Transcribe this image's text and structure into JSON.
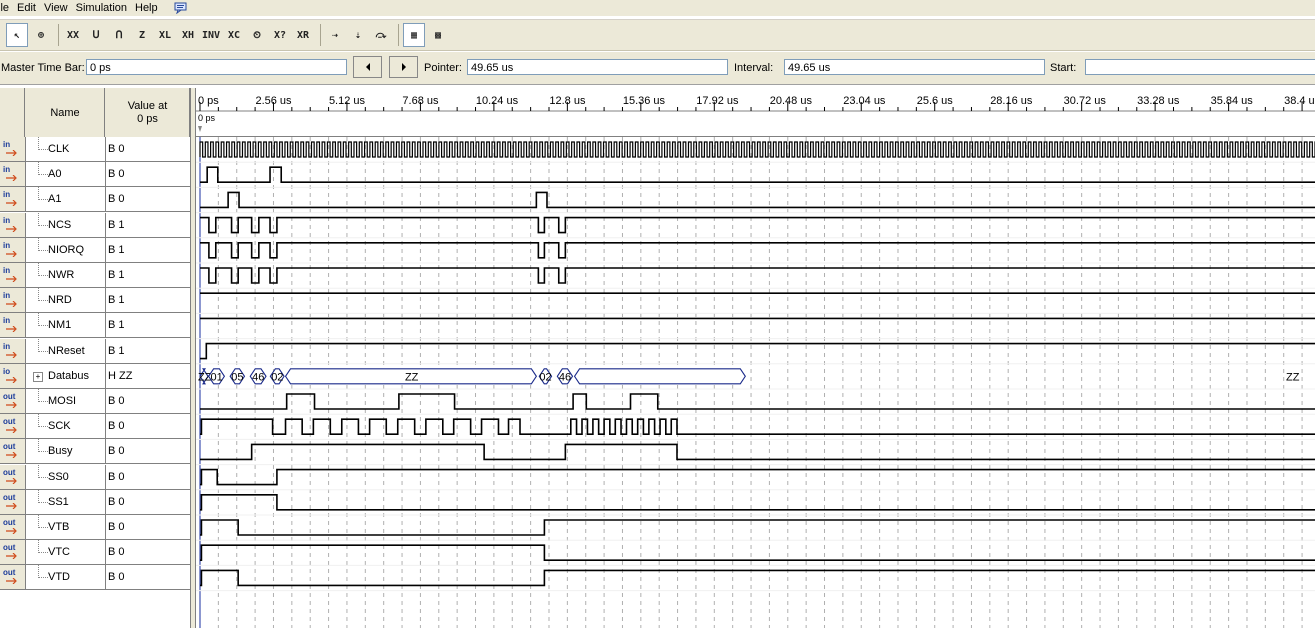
{
  "menu": {
    "items": [
      "ile",
      "Edit",
      "View",
      "Simulation",
      "Help"
    ]
  },
  "toolbar": {
    "buttons": [
      {
        "icon": "selection-tool-icon",
        "text": "↖"
      },
      {
        "icon": "zoom-tool-icon",
        "text": "⊕"
      },
      {
        "icon": "uninitialized-icon",
        "text": "XX"
      },
      {
        "icon": "forcing-low-icon",
        "text": "ᑌ"
      },
      {
        "icon": "forcing-high-icon",
        "text": "ᑎ"
      },
      {
        "icon": "high-impedance-icon",
        "text": "Z"
      },
      {
        "icon": "weak-low-icon",
        "text": "XL"
      },
      {
        "icon": "weak-high-icon",
        "text": "XH"
      },
      {
        "icon": "invert-icon",
        "text": "INV"
      },
      {
        "icon": "count-value-icon",
        "text": "XC"
      },
      {
        "icon": "clock-icon",
        "text": "⏲"
      },
      {
        "icon": "arbitrary-value-icon",
        "text": "X?"
      },
      {
        "icon": "random-values-icon",
        "text": "XR"
      },
      {
        "icon": "snap-to-grid-icon",
        "text": "⇢"
      },
      {
        "icon": "sort-icon",
        "text": "⇣"
      },
      {
        "icon": "group-icon",
        "text": "⤼"
      },
      {
        "icon": "overwrite-icon",
        "text": "▦"
      },
      {
        "icon": "grid-icon",
        "text": "▩"
      }
    ]
  },
  "timebar": {
    "master_label": "Master Time Bar:",
    "master_value": "0 ps",
    "pointer_label": "Pointer:",
    "pointer_value": "49.65 us",
    "interval_label": "Interval:",
    "interval_value": "49.65 us",
    "start_label": "Start:",
    "start_value": ""
  },
  "header": {
    "name": "Name",
    "value_at": "Value at",
    "value_at_time": "0 ps",
    "cursor_label": "0 ps"
  },
  "time_ticks": [
    "0 ps",
    "2.56 us",
    "5.12 us",
    "7.68 us",
    "10.24 us",
    "12.8 us",
    "15.36 us",
    "17.92 us",
    "20.48 us",
    "23.04 us",
    "25.6 us",
    "28.16 us",
    "30.72 us",
    "33.28 us",
    "35.84 us",
    "38.4 us"
  ],
  "signals": [
    {
      "dir": "in",
      "name": "CLK",
      "value": "B 0"
    },
    {
      "dir": "in",
      "name": "A0",
      "value": "B 0"
    },
    {
      "dir": "in",
      "name": "A1",
      "value": "B 0"
    },
    {
      "dir": "in",
      "name": "NCS",
      "value": "B 1"
    },
    {
      "dir": "in",
      "name": "NIORQ",
      "value": "B 1"
    },
    {
      "dir": "in",
      "name": "NWR",
      "value": "B 1"
    },
    {
      "dir": "in",
      "name": "NRD",
      "value": "B 1"
    },
    {
      "dir": "in",
      "name": "NM1",
      "value": "B 1"
    },
    {
      "dir": "in",
      "name": "NReset",
      "value": "B 1"
    },
    {
      "dir": "io",
      "name": "Databus",
      "value": "H ZZ"
    },
    {
      "dir": "out",
      "name": "MOSI",
      "value": "B 0"
    },
    {
      "dir": "out",
      "name": "SCK",
      "value": "B 0"
    },
    {
      "dir": "out",
      "name": "Busy",
      "value": "B 0"
    },
    {
      "dir": "out",
      "name": "SS0",
      "value": "B 0"
    },
    {
      "dir": "out",
      "name": "SS1",
      "value": "B 0"
    },
    {
      "dir": "out",
      "name": "VTB",
      "value": "B 0"
    },
    {
      "dir": "out",
      "name": "VTC",
      "value": "B 0"
    },
    {
      "dir": "out",
      "name": "VTD",
      "value": "B 0"
    }
  ],
  "waves": {
    "A0": [
      [
        0,
        0
      ],
      [
        0.25,
        1
      ],
      [
        0.62,
        0
      ],
      [
        2.44,
        1
      ],
      [
        2.83,
        0
      ]
    ],
    "A1": [
      [
        0,
        0
      ],
      [
        0.98,
        1
      ],
      [
        1.36,
        0
      ],
      [
        11.72,
        1
      ],
      [
        12.09,
        0
      ]
    ],
    "NCS": [
      [
        0,
        1
      ],
      [
        0.31,
        0
      ],
      [
        0.55,
        1
      ],
      [
        1.1,
        0
      ],
      [
        1.33,
        1
      ],
      [
        1.8,
        0
      ],
      [
        2.05,
        1
      ],
      [
        2.44,
        0
      ],
      [
        2.68,
        1
      ],
      [
        11.79,
        0
      ],
      [
        12.0,
        1
      ],
      [
        12.5,
        0
      ],
      [
        12.73,
        1
      ]
    ],
    "NIORQ": [
      [
        0,
        1
      ],
      [
        0.31,
        0
      ],
      [
        0.55,
        1
      ],
      [
        1.1,
        0
      ],
      [
        1.33,
        1
      ],
      [
        1.8,
        0
      ],
      [
        2.05,
        1
      ],
      [
        2.44,
        0
      ],
      [
        2.68,
        1
      ],
      [
        11.79,
        0
      ],
      [
        12.0,
        1
      ],
      [
        12.5,
        0
      ],
      [
        12.73,
        1
      ]
    ],
    "NWR": [
      [
        0,
        1
      ],
      [
        0.31,
        0
      ],
      [
        0.55,
        1
      ],
      [
        1.1,
        0
      ],
      [
        1.33,
        1
      ],
      [
        1.8,
        0
      ],
      [
        2.05,
        1
      ],
      [
        2.44,
        0
      ],
      [
        2.68,
        1
      ],
      [
        11.79,
        0
      ],
      [
        12.0,
        1
      ],
      [
        12.5,
        0
      ],
      [
        12.73,
        1
      ]
    ],
    "NRD": [
      [
        0,
        1
      ]
    ],
    "NM1": [
      [
        0,
        1
      ]
    ],
    "NReset": [
      [
        0,
        0
      ],
      [
        0.22,
        1
      ]
    ],
    "MOSI": [
      [
        0,
        0
      ],
      [
        3.02,
        1
      ],
      [
        3.99,
        0
      ],
      [
        6.93,
        1
      ],
      [
        8.87,
        0
      ],
      [
        13.0,
        1
      ],
      [
        13.46,
        0
      ],
      [
        15.0,
        1
      ],
      [
        15.95,
        0
      ]
    ],
    "SCK": [
      [
        0,
        0
      ],
      [
        0.05,
        1
      ],
      [
        2.53,
        0
      ],
      [
        2.98,
        1
      ],
      [
        3.56,
        0
      ],
      [
        3.95,
        1
      ],
      [
        4.54,
        0
      ],
      [
        4.94,
        1
      ],
      [
        5.52,
        0
      ],
      [
        5.91,
        1
      ],
      [
        6.49,
        0
      ],
      [
        6.89,
        1
      ],
      [
        7.48,
        0
      ],
      [
        7.87,
        1
      ],
      [
        8.46,
        0
      ],
      [
        8.84,
        1
      ],
      [
        9.43,
        0
      ],
      [
        9.81,
        1
      ],
      [
        10.4,
        0
      ],
      [
        10.75,
        1
      ],
      [
        11.15,
        0
      ],
      [
        12.92,
        1
      ],
      [
        13.12,
        0
      ],
      [
        13.31,
        1
      ],
      [
        13.5,
        0
      ],
      [
        13.69,
        1
      ],
      [
        13.89,
        0
      ],
      [
        14.08,
        1
      ],
      [
        14.28,
        0
      ],
      [
        14.47,
        1
      ],
      [
        14.67,
        0
      ],
      [
        14.86,
        1
      ],
      [
        15.06,
        0
      ],
      [
        15.25,
        1
      ],
      [
        15.45,
        0
      ],
      [
        15.64,
        1
      ],
      [
        15.84,
        0
      ],
      [
        16.03,
        1
      ],
      [
        16.23,
        0
      ],
      [
        16.42,
        1
      ],
      [
        16.62,
        0
      ]
    ],
    "Busy": [
      [
        0,
        0
      ],
      [
        1.8,
        1
      ],
      [
        9.9,
        0
      ],
      [
        12.73,
        1
      ],
      [
        16.62,
        0
      ]
    ],
    "SS0": [
      [
        0,
        0
      ],
      [
        0.05,
        1
      ],
      [
        0.6,
        0
      ],
      [
        2.68,
        1
      ]
    ],
    "SS1": [
      [
        0,
        0
      ],
      [
        0.05,
        1
      ],
      [
        2.68,
        0
      ]
    ],
    "VTB": [
      [
        0,
        0
      ],
      [
        0.05,
        1
      ],
      [
        1.33,
        0
      ],
      [
        12.0,
        1
      ]
    ],
    "VTC": [
      [
        0,
        0
      ],
      [
        0.05,
        1
      ],
      [
        12.0,
        0
      ]
    ],
    "VTD": [
      [
        0,
        0
      ],
      [
        0.05,
        1
      ],
      [
        1.33,
        0
      ],
      [
        12.0,
        1
      ]
    ],
    "Databus": [
      {
        "from": 0,
        "to": 0.28,
        "label": "ZZ"
      },
      {
        "from": 0.3,
        "to": 0.85,
        "label": "01"
      },
      {
        "from": 1.05,
        "to": 1.55,
        "label": "05"
      },
      {
        "from": 1.75,
        "to": 2.3,
        "label": "46"
      },
      {
        "from": 2.45,
        "to": 2.93,
        "label": "02"
      },
      {
        "from": 2.98,
        "to": 11.72,
        "label": "ZZ"
      },
      {
        "from": 11.82,
        "to": 12.25,
        "label": "02"
      },
      {
        "from": 12.45,
        "to": 12.98,
        "label": "46"
      },
      {
        "from": 13.05,
        "to": 19.0,
        "label": "ZZ"
      }
    ]
  }
}
